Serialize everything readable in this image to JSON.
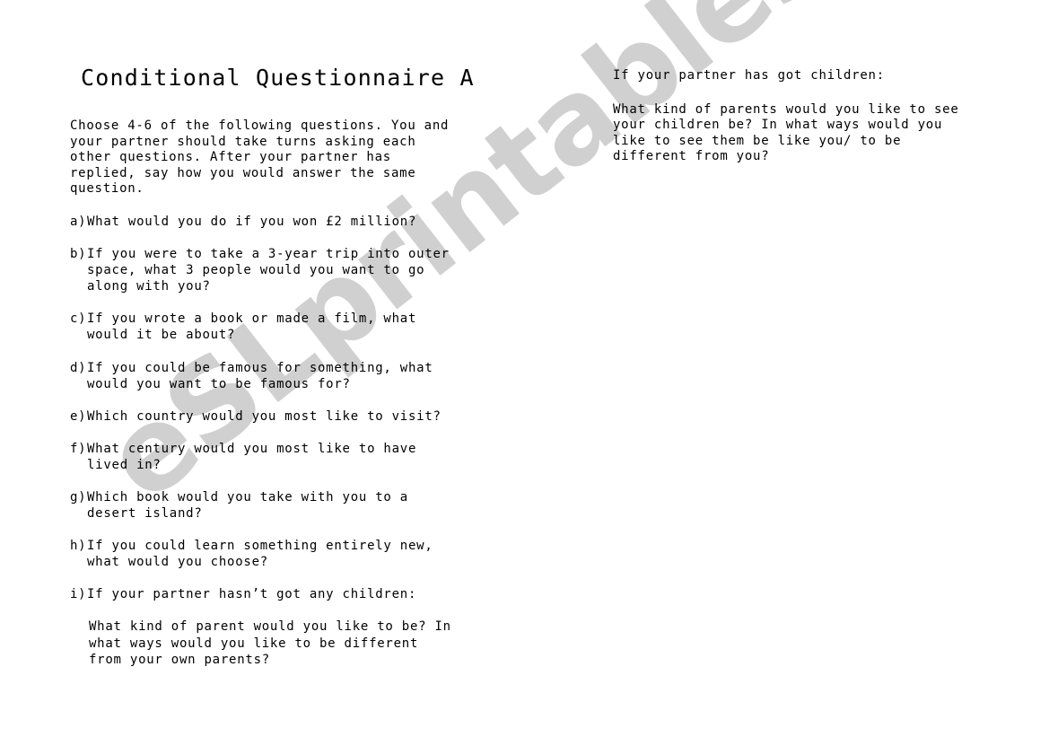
{
  "document": {
    "title": "Conditional Questionnaire A",
    "intro": "Choose 4-6 of the following questions. You and\nyour partner should take turns asking each\nother questions. After your partner has\nreplied, say how you would answer the same\nquestion.",
    "questions": [
      {
        "marker": "a)",
        "text": "What would you do if you won £2 million?"
      },
      {
        "marker": "b)",
        "text": "If you were to take a 3-year trip into outer\nspace, what 3 people would you want to go\nalong with you?"
      },
      {
        "marker": "c)",
        "text": "If you wrote a book or made a film, what\nwould it be about?"
      },
      {
        "marker": "d)",
        "text": "If you could be famous for something, what\nwould you want to be famous for?"
      },
      {
        "marker": "e)",
        "text": "Which country would you most like to visit?"
      },
      {
        "marker": "f)",
        "text": "What century would you most like to have\nlived in?"
      },
      {
        "marker": "g)",
        "text": "Which book would you take with you to a\ndesert island?"
      },
      {
        "marker": "h)",
        "text": "If you could learn something entirely new,\nwhat would you choose?"
      },
      {
        "marker": "i)",
        "text": "If your partner hasn’t got any children:"
      }
    ],
    "question_i_body": "What kind of parent would you like to be? In\nwhat ways would you like to be different\nfrom your own parents?",
    "right_column": {
      "lead": "If your partner has got children:",
      "body": "What kind of parents would you like to see\nyour children be? In what ways would you\nlike to see them be like you/ to be\ndifferent from you?"
    },
    "watermark": {
      "text": "eSLprintables.com",
      "color": "#d0d0d0"
    }
  }
}
